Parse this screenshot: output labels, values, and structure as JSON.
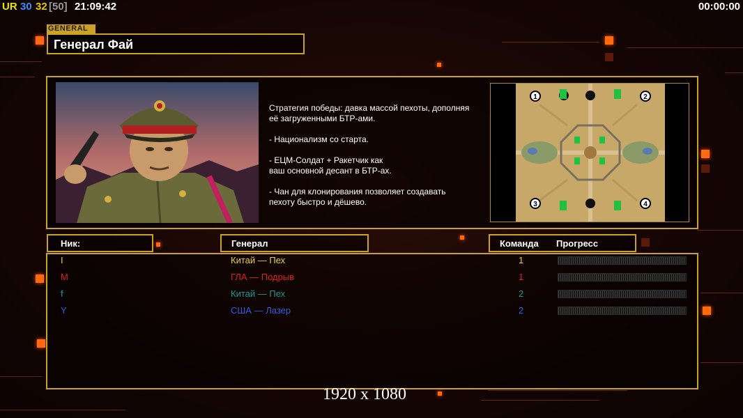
{
  "topbar": {
    "ur_label": "UR",
    "fps": "30",
    "fps_target": "32",
    "fps_limit": "[50]",
    "clock": "21:09:42",
    "timer": "00:00:00"
  },
  "general": {
    "tag": "GENERAL",
    "name": "Генерал Фай",
    "description": [
      "Стратегия победы: давка массой пехоты, дополняя\n её загруженными БТР-ами.",
      "- Национализм со старта.",
      "- ЕЦМ-Солдат + Ракетчик как\nваш основной десант в БТР-ах.",
      "- Чан для клонирования позволяет создавать\n пехоту быстро и дёшево."
    ]
  },
  "map": {
    "start_positions": [
      "1",
      "2",
      "3",
      "4"
    ]
  },
  "table": {
    "headers": {
      "nick": "Ник:",
      "general": "Генерал",
      "team": "Команда",
      "progress": "Прогресс"
    },
    "rows": [
      {
        "nick": "I",
        "general": "Китай — Пех",
        "team": "1",
        "color": "#e6d23c"
      },
      {
        "nick": "M",
        "general": "ГЛА — Подрыв",
        "team": "1",
        "color": "#e0201c"
      },
      {
        "nick": "f",
        "general": "Китай — Пех",
        "team": "2",
        "color": "#1e9a96"
      },
      {
        "nick": "Y",
        "general": "США — Лазер",
        "team": "2",
        "color": "#3c58e6"
      }
    ]
  },
  "footer": {
    "resolution": "1920 x 1080"
  },
  "colors": {
    "accent_gold": "#c9a227",
    "ur": "#e6e600",
    "fps": "#3c8cff",
    "fps_target": "#e6c800",
    "fps_limit": "#999999"
  }
}
